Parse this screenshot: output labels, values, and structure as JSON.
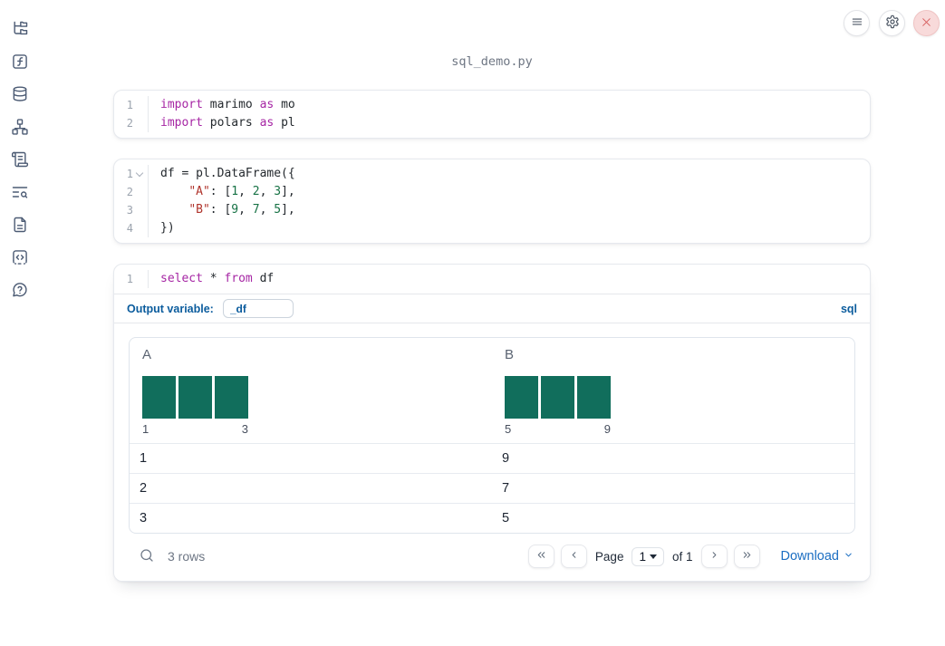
{
  "app": {
    "title": "sql_demo.py"
  },
  "colors": {
    "accent_blue": "#0b5c9d",
    "link_blue": "#1b6ec2",
    "histogram_teal": "#116e5c",
    "keyword_purple": "#a626a4",
    "string_red": "#b0342c",
    "number_green": "#177245",
    "close_red": "#d65f5f",
    "sidebar_icon": "#4c5b74"
  },
  "topbar": {
    "buttons": [
      {
        "icon": "menu-icon"
      },
      {
        "icon": "settings-gear-icon"
      },
      {
        "icon": "close-x-icon"
      }
    ]
  },
  "sidebar": {
    "items": [
      {
        "icon": "folder-tree-icon"
      },
      {
        "icon": "function-square-icon"
      },
      {
        "icon": "database-icon"
      },
      {
        "icon": "dependency-graph-icon"
      },
      {
        "icon": "scroll-text-icon"
      },
      {
        "icon": "list-search-icon"
      },
      {
        "icon": "file-text-icon"
      },
      {
        "icon": "code-snippet-icon"
      },
      {
        "icon": "help-bubble-icon"
      }
    ]
  },
  "cells": [
    {
      "id": "imports",
      "lines": [
        {
          "num": "1",
          "fold": false,
          "tokens": [
            [
              "kw",
              "import"
            ],
            [
              "plain",
              " marimo "
            ],
            [
              "kw",
              "as"
            ],
            [
              "plain",
              " mo"
            ]
          ]
        },
        {
          "num": "2",
          "fold": false,
          "tokens": [
            [
              "kw",
              "import"
            ],
            [
              "plain",
              " polars "
            ],
            [
              "kw",
              "as"
            ],
            [
              "plain",
              " pl"
            ]
          ]
        }
      ]
    },
    {
      "id": "dataframe",
      "lines": [
        {
          "num": "1",
          "fold": true,
          "tokens": [
            [
              "plain",
              "df = pl.DataFrame({"
            ]
          ]
        },
        {
          "num": "2",
          "fold": false,
          "tokens": [
            [
              "plain",
              "    "
            ],
            [
              "str",
              "\"A\""
            ],
            [
              "plain",
              ": ["
            ],
            [
              "num",
              "1"
            ],
            [
              "plain",
              ", "
            ],
            [
              "num",
              "2"
            ],
            [
              "plain",
              ", "
            ],
            [
              "num",
              "3"
            ],
            [
              "plain",
              "],"
            ]
          ]
        },
        {
          "num": "3",
          "fold": false,
          "tokens": [
            [
              "plain",
              "    "
            ],
            [
              "str",
              "\"B\""
            ],
            [
              "plain",
              ": ["
            ],
            [
              "num",
              "9"
            ],
            [
              "plain",
              ", "
            ],
            [
              "num",
              "7"
            ],
            [
              "plain",
              ", "
            ],
            [
              "num",
              "5"
            ],
            [
              "plain",
              "],"
            ]
          ]
        },
        {
          "num": "4",
          "fold": false,
          "tokens": [
            [
              "plain",
              "})"
            ]
          ]
        }
      ]
    },
    {
      "id": "sql-query",
      "lines": [
        {
          "num": "1",
          "fold": false,
          "tokens": [
            [
              "kw",
              "select"
            ],
            [
              "plain",
              " * "
            ],
            [
              "kw",
              "from"
            ],
            [
              "plain",
              " df"
            ]
          ]
        }
      ],
      "output_variable_label": "Output variable:",
      "output_variable_value": "_df",
      "language_badge": "sql"
    }
  ],
  "table": {
    "columns": [
      {
        "name": "A",
        "histogram": {
          "bar_values": [
            1,
            1,
            1
          ],
          "min_label": "1",
          "max_label": "3"
        }
      },
      {
        "name": "B",
        "histogram": {
          "bar_values": [
            1,
            1,
            1
          ],
          "min_label": "5",
          "max_label": "9"
        }
      }
    ],
    "rows": [
      [
        "1",
        "9"
      ],
      [
        "2",
        "7"
      ],
      [
        "3",
        "5"
      ]
    ],
    "footer": {
      "row_count": "3 rows",
      "page_label": "Page",
      "page_value": "1",
      "of_label": "of 1",
      "download_label": "Download"
    }
  }
}
